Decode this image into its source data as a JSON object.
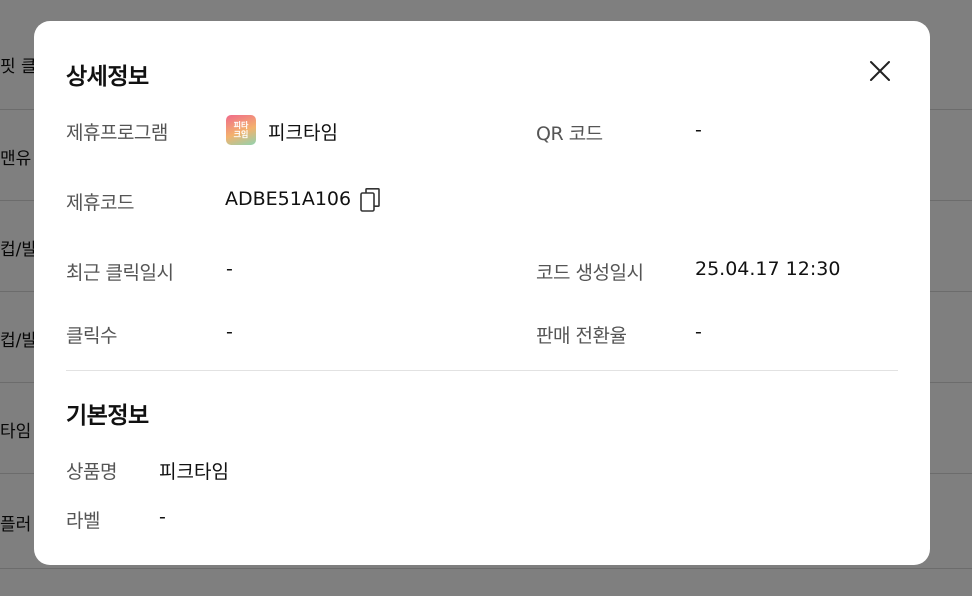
{
  "background": {
    "rows": [
      "핏 클릭",
      "맨유",
      "컵/발목",
      "컵/발목",
      "타임",
      "플러"
    ]
  },
  "modal": {
    "title": "상세정보",
    "close_icon": "close-icon",
    "details": {
      "program_label": "제휴프로그램",
      "program_logo_text": "피타\n크임",
      "program_name": "피크타임",
      "qr_label": "QR 코드",
      "qr_value": "-",
      "code_label": "제휴코드",
      "code_value": "ADBE51A106",
      "copy_icon": "copy-icon",
      "recent_click_label": "최근 클릭일시",
      "recent_click_value": "-",
      "created_label": "코드 생성일시",
      "created_value": "25.04.17 12:30",
      "clicks_label": "클릭수",
      "clicks_value": "-",
      "conversion_label": "판매 전환율",
      "conversion_value": "-"
    },
    "basic_info": {
      "title": "기본정보",
      "product_label": "상품명",
      "product_value": "피크타임",
      "tag_label": "라벨",
      "tag_value": "-"
    }
  }
}
